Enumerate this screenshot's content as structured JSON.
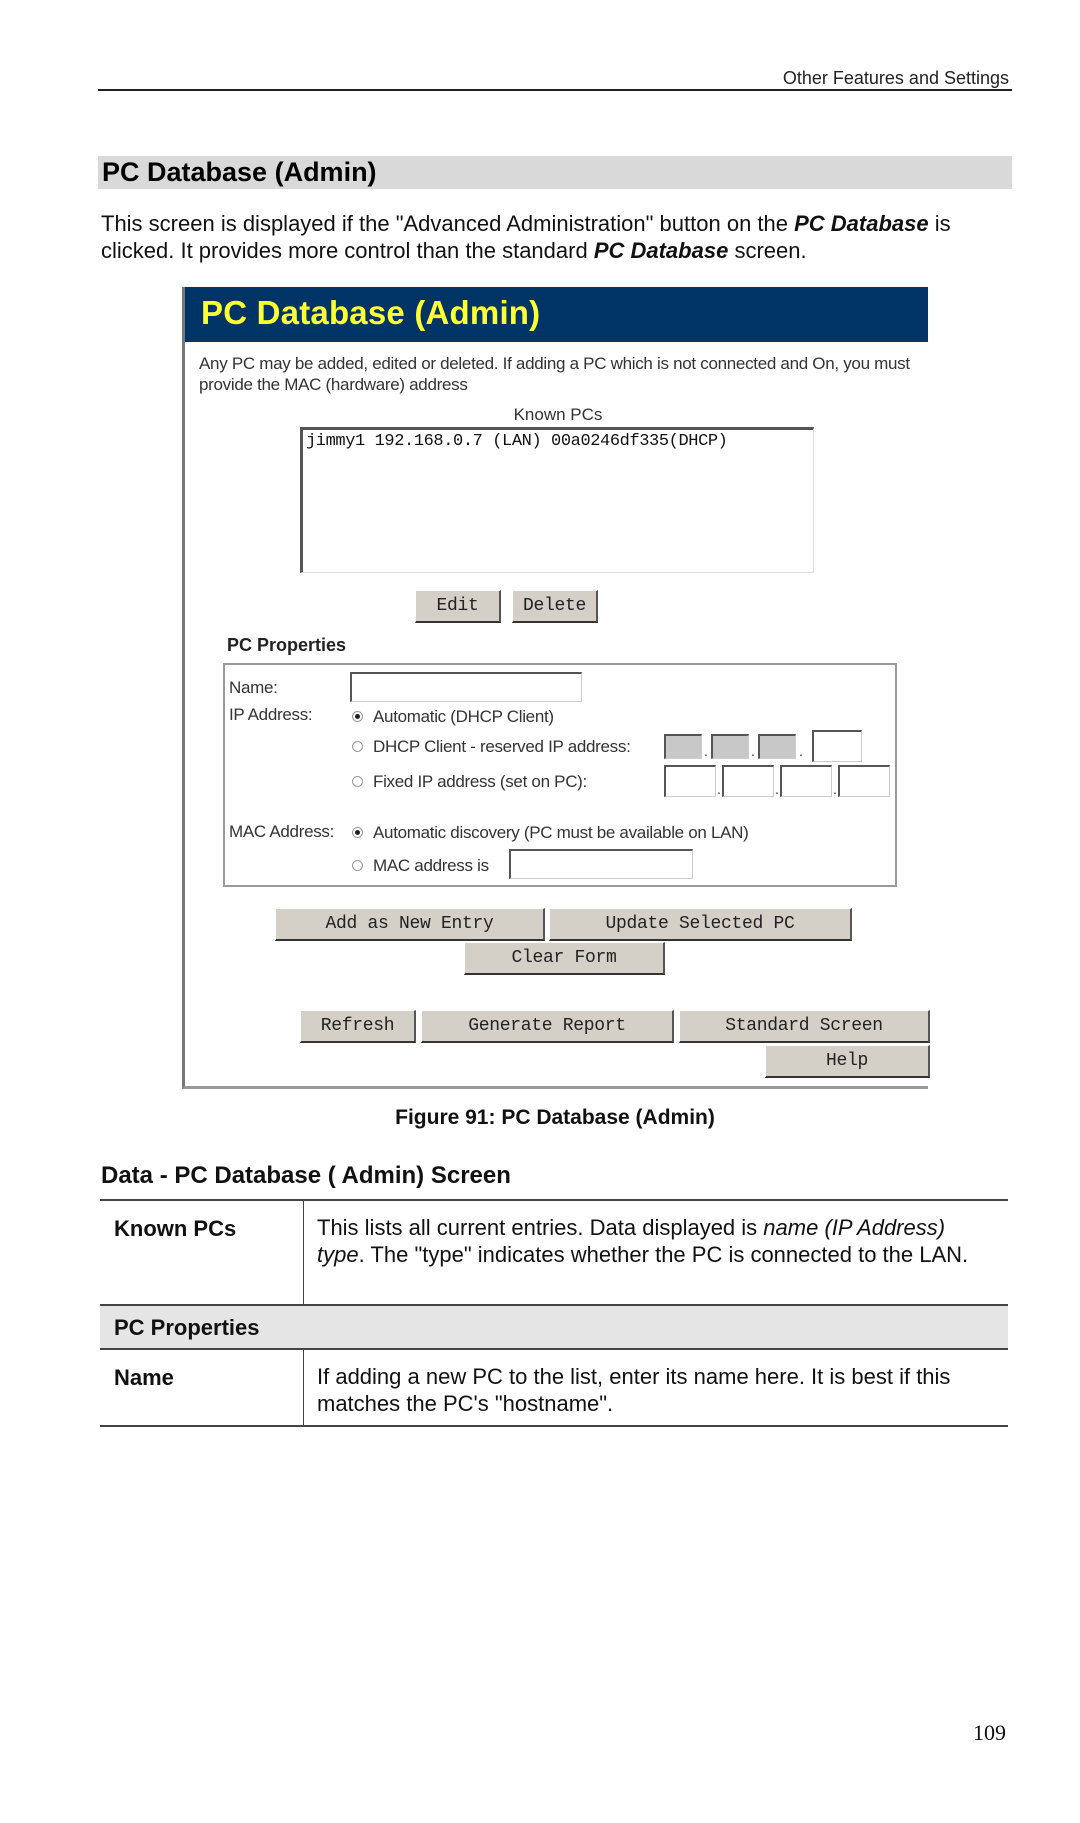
{
  "header": {
    "running_title": "Other Features and Settings"
  },
  "section": {
    "title": "PC Database (Admin)",
    "intro": {
      "part1": "This screen is displayed if the \"Advanced Administration\" button on the ",
      "em1": "PC Database",
      "part2": " is clicked. It provides more control than the standard ",
      "em2": "PC Database",
      "part3": " screen."
    }
  },
  "screenshot": {
    "title": "PC Database (Admin)",
    "colors": {
      "header_bg": "#003366",
      "header_text": "#ffff33",
      "button_bg": "#d4d0c8"
    },
    "description": "Any PC may be added, edited or deleted. If adding a PC which is not connected and On, you must provide the MAC (hardware) address",
    "known_pcs": {
      "label": "Known PCs",
      "entries": [
        "jimmy1 192.168.0.7 (LAN) 00a0246df335(DHCP)"
      ]
    },
    "list_buttons": {
      "edit": "Edit",
      "delete": "Delete"
    },
    "properties": {
      "heading": "PC Properties",
      "name_label": "Name:",
      "name_value": "",
      "ip_label": "IP Address:",
      "ip_options": [
        {
          "label": "Automatic (DHCP Client)",
          "selected": true
        },
        {
          "label": "DHCP Client - reserved IP address:",
          "selected": false
        },
        {
          "label": "Fixed IP address (set on PC):",
          "selected": false
        }
      ],
      "mac_label": "MAC Address:",
      "mac_options": [
        {
          "label": "Automatic discovery (PC must be available on LAN)",
          "selected": true
        },
        {
          "label": "MAC address is",
          "selected": false
        }
      ],
      "mac_value": ""
    },
    "action_buttons": {
      "add": "Add as New Entry",
      "update": "Update Selected PC",
      "clear": "Clear Form",
      "refresh": "Refresh",
      "report": "Generate Report",
      "standard": "Standard Screen",
      "help": "Help"
    }
  },
  "figure_caption": "Figure 91: PC Database (Admin)",
  "data_section": {
    "heading": "Data - PC Database ( Admin) Screen",
    "rows": [
      {
        "key": "Known PCs",
        "value_a": "This lists all current entries. Data displayed is ",
        "value_em": "name (IP Address) type",
        "value_b": ". The \"type\" indicates whether the PC is connected to the LAN."
      },
      {
        "group": "PC Properties"
      },
      {
        "key": "Name",
        "value": "If adding a new PC to the list, enter its name here. It is best if this matches the PC's \"hostname\"."
      }
    ]
  },
  "page_number": "109"
}
